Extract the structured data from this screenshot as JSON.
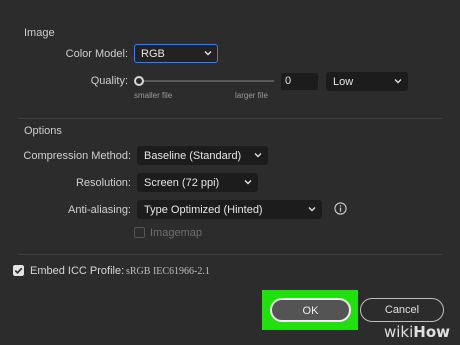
{
  "image_section": {
    "title": "Image",
    "color_model": {
      "label": "Color Model:",
      "value": "RGB"
    },
    "quality": {
      "label": "Quality:",
      "value": "0",
      "level": 0,
      "low_label": "smaller file",
      "high_label": "larger file",
      "preset": "Low"
    }
  },
  "options_section": {
    "title": "Options",
    "compression": {
      "label": "Compression Method:",
      "value": "Baseline (Standard)"
    },
    "resolution": {
      "label": "Resolution:",
      "value": "Screen (72 ppi)"
    },
    "antialiasing": {
      "label": "Anti-aliasing:",
      "value": "Type Optimized (Hinted)"
    },
    "imagemap": {
      "label": "Imagemap",
      "checked": false,
      "disabled": true
    }
  },
  "icc": {
    "label": "Embed ICC Profile:",
    "profile": "sRGB IEC61966-2.1",
    "checked": true
  },
  "buttons": {
    "ok": "OK",
    "cancel": "Cancel"
  },
  "watermark": {
    "wiki": "wiki",
    "how": "How"
  },
  "colors": {
    "background": "#2c2c2c",
    "field": "#1c1c1c",
    "focus": "#3b7de8",
    "highlight": "#22e010",
    "checkbox": "#e3e3e3"
  }
}
